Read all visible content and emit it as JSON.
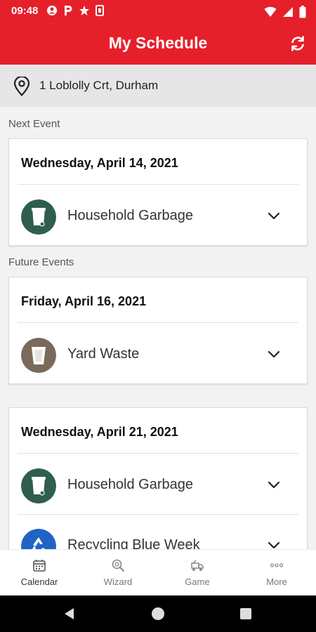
{
  "status_bar": {
    "time": "09:48"
  },
  "header": {
    "title": "My Schedule"
  },
  "address": {
    "text": "1 Loblolly Crt, Durham"
  },
  "sections": {
    "next": "Next Event",
    "future": "Future Events"
  },
  "cards": [
    {
      "date": "Wednesday, April 14, 2021",
      "events": [
        {
          "label": "Household Garbage",
          "icon": "garbage-bin-icon",
          "color": "#2f5e4e"
        }
      ]
    },
    {
      "date": "Friday, April 16, 2021",
      "events": [
        {
          "label": "Yard Waste",
          "icon": "yard-waste-bin-icon",
          "color": "#7a6a5a"
        }
      ]
    },
    {
      "date": "Wednesday, April 21, 2021",
      "events": [
        {
          "label": "Household Garbage",
          "icon": "garbage-bin-icon",
          "color": "#2f5e4e"
        },
        {
          "label": "Recycling Blue Week",
          "icon": "recycling-icon",
          "color": "#1f63c6"
        }
      ]
    }
  ],
  "bottom_nav": [
    {
      "label": "Calendar",
      "icon": "calendar-icon",
      "active": true
    },
    {
      "label": "Wizard",
      "icon": "search-magnifier-icon",
      "active": false
    },
    {
      "label": "Game",
      "icon": "game-truck-icon",
      "active": false
    },
    {
      "label": "More",
      "icon": "more-dots-icon",
      "active": false
    }
  ],
  "colors": {
    "brand": "#e5202b",
    "garbage": "#2f5e4e",
    "yard": "#7a6a5a",
    "recycling": "#1f63c6"
  }
}
